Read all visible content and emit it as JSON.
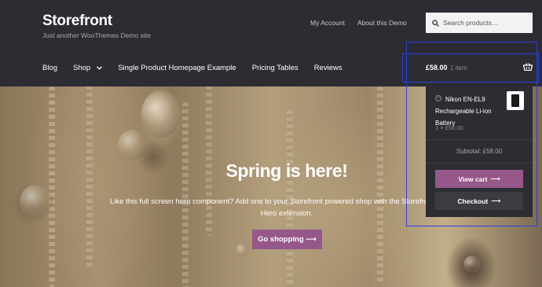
{
  "site": {
    "title": "Storefront",
    "tagline": "Just another WooThemes Demo site"
  },
  "secondary_nav": [
    "My Account",
    "About this Demo"
  ],
  "search": {
    "placeholder": "Search products…",
    "icon": "search-icon"
  },
  "primary_nav": [
    {
      "label": "Blog"
    },
    {
      "label": "Shop",
      "has_dropdown": true
    },
    {
      "label": "Single Product Homepage Example"
    },
    {
      "label": "Pricing Tables"
    },
    {
      "label": "Reviews"
    }
  ],
  "cart": {
    "amount": "£58.00",
    "count": "1 item",
    "icon": "basket-icon"
  },
  "minicart": {
    "item_name": "Nikon EN-EL9 Rechargeable Li-ion Battery",
    "item_qty": "1 × £58.00",
    "subtotal": "Subtotal: £58.00",
    "view_cart": "View cart",
    "checkout": "Checkout",
    "arrow": "⟶"
  },
  "hero": {
    "title": "Spring is here!",
    "text": "Like this full screen hero component? Add one to your Storefront powered shop with the Storefront Parallax Hero extension.",
    "button": "Go shopping ⟶"
  },
  "colors": {
    "header_bg": "#2c2d33",
    "accent": "#96588a",
    "highlight_box": "#2a3fe0"
  }
}
